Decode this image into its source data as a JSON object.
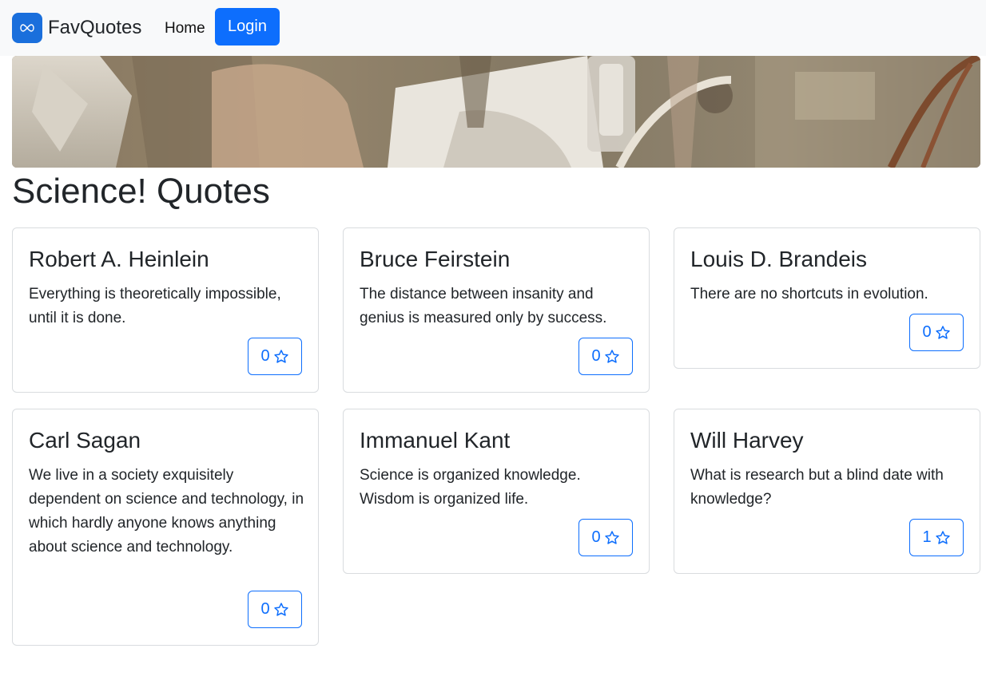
{
  "navbar": {
    "brand_name": "FavQuotes",
    "home_label": "Home",
    "login_label": "Login"
  },
  "page": {
    "title": "Science! Quotes"
  },
  "quotes": [
    {
      "author": "Robert A. Heinlein",
      "text": "Everything is theoretically impossible, until it is done.",
      "favorites": "0"
    },
    {
      "author": "Bruce Feirstein",
      "text": "The distance between insanity and genius is measured only by success.",
      "favorites": "0"
    },
    {
      "author": "Louis D. Brandeis",
      "text": "There are no shortcuts in evolution.",
      "favorites": "0"
    },
    {
      "author": "Carl Sagan",
      "text": "We live in a society exquisitely dependent on science and technology, in which hardly anyone knows anything about science and technology.",
      "favorites": "0"
    },
    {
      "author": "Immanuel Kant",
      "text": "Science is organized knowledge. Wisdom is organized life.",
      "favorites": "0"
    },
    {
      "author": "Will Harvey",
      "text": "What is research but a blind date with knowledge?",
      "favorites": "1"
    }
  ],
  "icons": {
    "brand_logo": "infinity-logo-icon",
    "favorite": "star-outline-icon"
  },
  "colors": {
    "primary": "#0d6efd",
    "brand_logo_bg": "#1a6fdc",
    "navbar_bg": "#f8f9fa"
  }
}
